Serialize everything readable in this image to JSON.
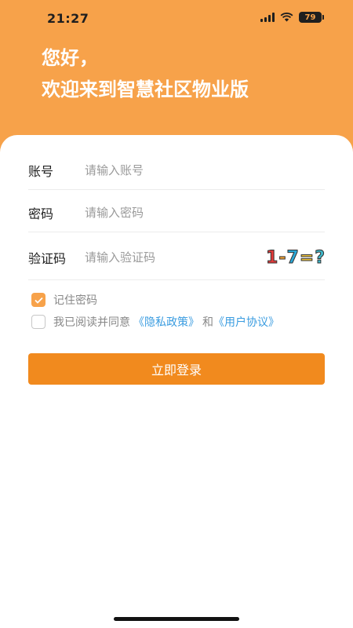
{
  "status_bar": {
    "time": "21:27",
    "battery": "79"
  },
  "header": {
    "greeting_line1": "您好，",
    "greeting_line2": "欢迎来到智慧社区物业版"
  },
  "form": {
    "account_label": "账号",
    "account_placeholder": "请输入账号",
    "password_label": "密码",
    "password_placeholder": "请输入密码",
    "captcha_label": "验证码",
    "captcha_placeholder": "请输入验证码",
    "captcha_glyphs": [
      "1",
      "-",
      "7",
      "=",
      "?"
    ]
  },
  "options": {
    "remember_label": "记住密码",
    "remember_checked": true,
    "agree_prefix": "我已阅读并同意",
    "privacy_link": "《隐私政策》",
    "and_text": "和",
    "agreement_link": "《用户协议》",
    "agree_checked": false
  },
  "login_button": "立即登录",
  "colors": {
    "header_bg": "#F7A24A",
    "button_bg": "#F18A1E",
    "link": "#3A9CE0"
  }
}
